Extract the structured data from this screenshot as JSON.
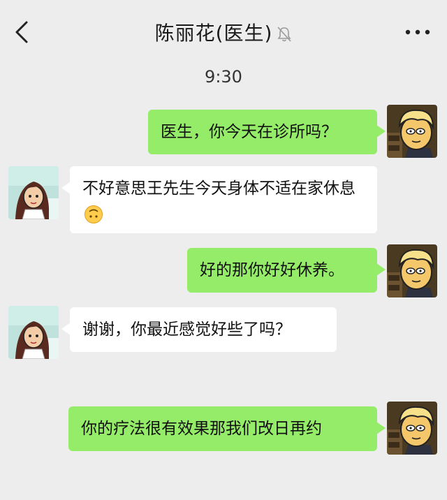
{
  "header": {
    "back_icon": "chevron-left-icon",
    "title": "陈丽花(医生)",
    "mute_icon": "bell-off-icon",
    "more_icon": "more-dots-icon"
  },
  "chat": {
    "timestamp": "9:30",
    "messages": [
      {
        "sender": "me",
        "text": "医生，你今天在诊所吗？"
      },
      {
        "sender": "them",
        "text": "不好意思王先生今天身体不适在家休息",
        "emoji": "upside-down-face-emoji"
      },
      {
        "sender": "me",
        "text": "好的那你好好休养。"
      },
      {
        "sender": "them",
        "text": "谢谢，你最近感觉好些了吗？"
      },
      {
        "sender": "me",
        "text": "你的疗法很有效果那我们改日再约"
      }
    ]
  },
  "colors": {
    "background": "#ededed",
    "my_bubble": "#95ec69",
    "their_bubble": "#ffffff"
  }
}
